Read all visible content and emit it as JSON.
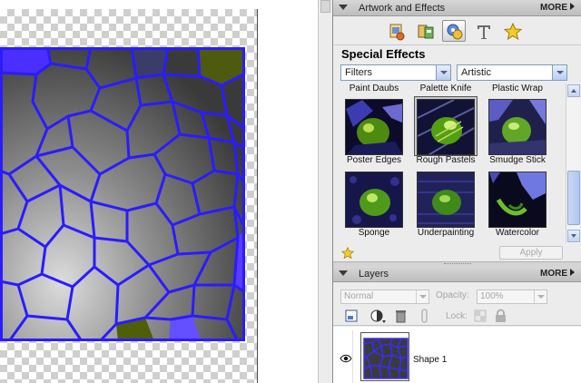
{
  "artwork_panel": {
    "title": "Artwork and Effects",
    "more": "MORE"
  },
  "category_icons": [
    "artwork-icon",
    "graphics-icon",
    "effects-icon",
    "text-icon",
    "favorites-star-icon"
  ],
  "special_effects": {
    "title": "Special Effects",
    "type_dropdown": "Filters",
    "category_dropdown": "Artistic",
    "top_row": [
      "Paint Daubs",
      "Palette Knife",
      "Plastic Wrap"
    ],
    "items": [
      {
        "label": "Poster Edges",
        "selected": false
      },
      {
        "label": "Rough Pastels",
        "selected": true
      },
      {
        "label": "Smudge Stick",
        "selected": false
      },
      {
        "label": "Sponge",
        "selected": false
      },
      {
        "label": "Underpainting",
        "selected": false
      },
      {
        "label": "Watercolor",
        "selected": false
      }
    ],
    "apply": "Apply"
  },
  "layers_panel": {
    "title": "Layers",
    "more": "MORE",
    "blend_mode": "Normal",
    "opacity_label": "Opacity:",
    "opacity_value": "100%",
    "lock_label": "Lock:",
    "layer_name": "Shape 1"
  },
  "colors": {
    "accent_blue": "#2a1cff",
    "cell_fill_dark": "#4a4a4a",
    "cell_fill_light": "#bdbdbd",
    "olive": "#4f5e08",
    "bright_blue": "#5038ff"
  }
}
